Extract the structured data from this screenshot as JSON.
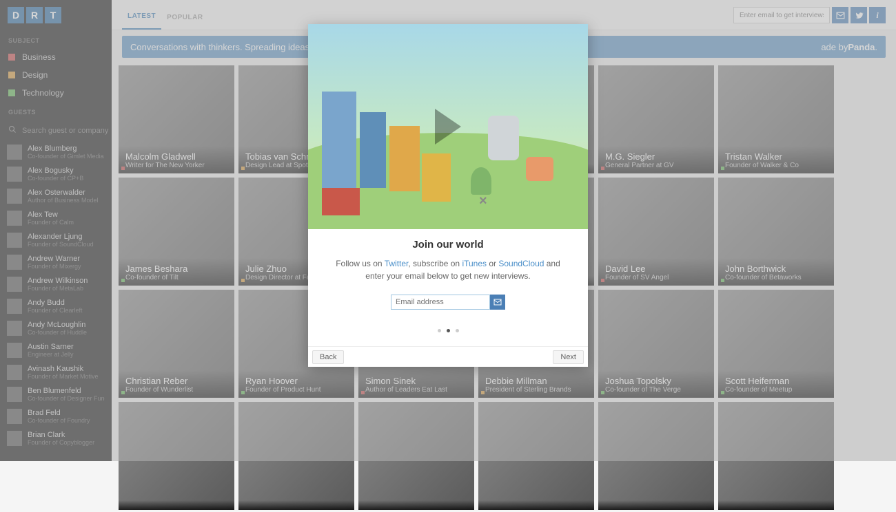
{
  "logo_letters": [
    "D",
    "R",
    "T"
  ],
  "sidebar": {
    "subject_header": "SUBJECT",
    "subjects": [
      {
        "label": "Business",
        "color": "#c94b4b"
      },
      {
        "label": "Design",
        "color": "#d89a3a"
      },
      {
        "label": "Technology",
        "color": "#5fb556"
      }
    ],
    "guests_header": "GUESTS",
    "search_placeholder": "Search guest or company",
    "guests": [
      {
        "name": "Alex Blumberg",
        "role": "Co-founder of Gimlet Media"
      },
      {
        "name": "Alex Bogusky",
        "role": "Co-founder of CP+B"
      },
      {
        "name": "Alex Osterwalder",
        "role": "Author of Business Model"
      },
      {
        "name": "Alex Tew",
        "role": "Founder of Calm"
      },
      {
        "name": "Alexander Ljung",
        "role": "Founder of SoundCloud"
      },
      {
        "name": "Andrew Warner",
        "role": "Founder of Mixergy"
      },
      {
        "name": "Andrew Wilkinson",
        "role": "Founder of MetaLab"
      },
      {
        "name": "Andy Budd",
        "role": "Founder of Clearleft"
      },
      {
        "name": "Andy McLoughlin",
        "role": "Co-founder of Huddle"
      },
      {
        "name": "Austin Sarner",
        "role": "Engineer at Jelly"
      },
      {
        "name": "Avinash Kaushik",
        "role": "Founder of Market Motive"
      },
      {
        "name": "Ben Blumenfeld",
        "role": "Co-founder of Designer Fund"
      },
      {
        "name": "Brad Feld",
        "role": "Co-founder of Foundry"
      },
      {
        "name": "Brian Clark",
        "role": "Founder of Copyblogger"
      }
    ]
  },
  "tabs": {
    "latest": "LATEST",
    "popular": "POPULAR"
  },
  "top": {
    "email_placeholder": "Enter email to get interviews"
  },
  "banner": {
    "text_left": "Conversations with thinkers. Spreading ideas in bu",
    "text_right": "ade by ",
    "brand": "Panda",
    "period": "."
  },
  "cards": [
    [
      {
        "name": "Malcolm Gladwell",
        "role": "Writer for The New Yorker",
        "dot": "#c94b4b"
      },
      {
        "name": "Tobias van Schn",
        "role": "Design Lead at Spotif",
        "dot": "#d89a3a"
      },
      {
        "name": "",
        "role": "",
        "dot": ""
      },
      {
        "name": "",
        "role": "",
        "dot": ""
      },
      {
        "name": "M.G. Siegler",
        "role": "General Partner at GV",
        "dot": "#c94b4b"
      },
      {
        "name": "Tristan Walker",
        "role": "Founder of Walker & Co",
        "dot": "#5fb556"
      }
    ],
    [
      {
        "name": "James Beshara",
        "role": "Co-founder of Tilt",
        "dot": "#5fb556"
      },
      {
        "name": "Julie Zhuo",
        "role": "Design Director at Fac",
        "dot": "#d89a3a"
      },
      {
        "name": "",
        "role": "",
        "dot": ""
      },
      {
        "name": "",
        "role": "",
        "dot": ""
      },
      {
        "name": "David Lee",
        "role": "Founder of SV Angel",
        "dot": "#c94b4b"
      },
      {
        "name": "John Borthwick",
        "role": "Co-founder of Betaworks",
        "dot": "#5fb556"
      }
    ],
    [
      {
        "name": "Christian Reber",
        "role": "Founder of Wunderlist",
        "dot": "#5fb556"
      },
      {
        "name": "Ryan Hoover",
        "role": "Founder of Product Hunt",
        "dot": "#5fb556"
      },
      {
        "name": "Simon Sinek",
        "role": "Author of Leaders Eat Last",
        "dot": "#c94b4b"
      },
      {
        "name": "Debbie Millman",
        "role": "President of Sterling Brands",
        "dot": "#d89a3a"
      },
      {
        "name": "Joshua Topolsky",
        "role": "Co-founder of The Verge",
        "dot": "#5fb556"
      },
      {
        "name": "Scott Heiferman",
        "role": "Co-founder of Meetup",
        "dot": "#5fb556"
      }
    ],
    [
      {
        "name": "",
        "role": "",
        "dot": ""
      },
      {
        "name": "",
        "role": "",
        "dot": ""
      },
      {
        "name": "",
        "role": "",
        "dot": ""
      },
      {
        "name": "",
        "role": "",
        "dot": ""
      },
      {
        "name": "",
        "role": "",
        "dot": ""
      },
      {
        "name": "",
        "role": "",
        "dot": ""
      }
    ]
  ],
  "modal": {
    "title": "Join our world",
    "desc_prefix": "Follow us on ",
    "twitter": "Twitter",
    "desc_mid1": ", subscribe on ",
    "itunes": "iTunes",
    "desc_mid2": " or ",
    "soundcloud": "SoundCloud",
    "desc_suffix": " and enter your email below to get new interviews.",
    "email_placeholder": "Email address",
    "back": "Back",
    "next": "Next"
  }
}
